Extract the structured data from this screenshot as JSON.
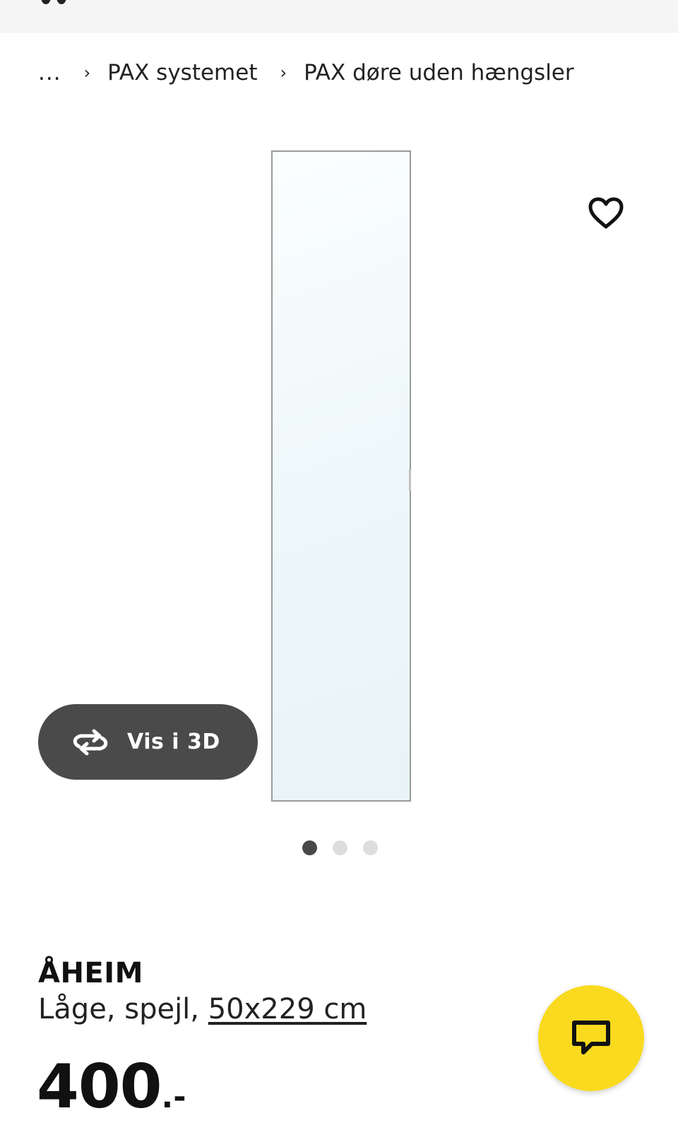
{
  "breadcrumb": {
    "ellipsis": "...",
    "separator": "›",
    "items": [
      {
        "label": "PAX systemet"
      },
      {
        "label": "PAX døre uden hængsler"
      }
    ]
  },
  "gallery": {
    "view_3d_label": "Vis i 3D",
    "image_count": 3,
    "active_index": 0
  },
  "product": {
    "name": "ÅHEIM",
    "description_prefix": "Låge, spejl, ",
    "size_link": "50x229 cm",
    "price": {
      "amount": "400",
      "suffix": ".-"
    }
  },
  "colors": {
    "accent_yellow": "#fada1f",
    "view3d_bg": "#4a4a4a",
    "dot_active": "#484848",
    "dot_inactive": "#dddddd"
  },
  "icons": {
    "favourite": "heart-icon",
    "view_3d": "rotate-3d-icon",
    "chat": "chat-icon"
  }
}
